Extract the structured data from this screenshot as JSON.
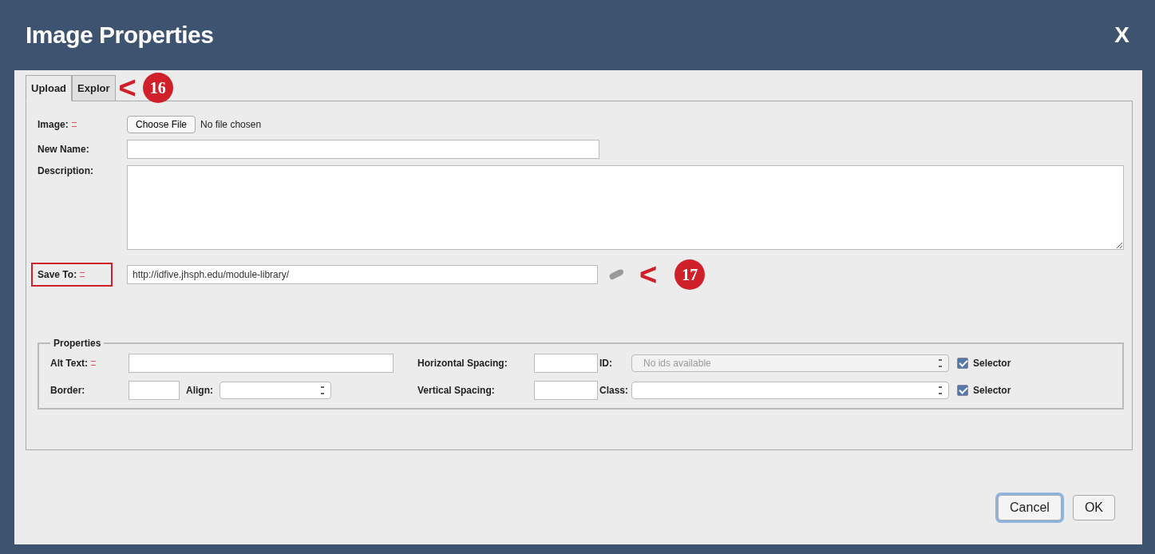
{
  "window": {
    "title": "Image Properties",
    "close": "X"
  },
  "tabs": [
    {
      "label": "Upload",
      "selected": true
    },
    {
      "label": "Explor",
      "selected": false
    }
  ],
  "callouts": [
    {
      "arrow": "<",
      "number": "16"
    },
    {
      "arrow": "<",
      "number": "17"
    }
  ],
  "upload": {
    "image": {
      "label": "Image:",
      "required": true,
      "button": "Choose File",
      "status": "No file chosen"
    },
    "new_name": {
      "label": "New Name:",
      "required": false
    },
    "description": {
      "label": "Description:",
      "required": false
    },
    "save_to": {
      "label": "Save To:",
      "required": true,
      "highlighted": true,
      "value": "http://idfive.jhsph.edu/module-library/"
    }
  },
  "properties": {
    "legend": "Properties",
    "alt_text": {
      "label": "Alt Text:",
      "required": true
    },
    "border": {
      "label": "Border:"
    },
    "align": {
      "label": "Align:"
    },
    "horizontal_spacing": {
      "label": "Horizontal Spacing:"
    },
    "vertical_spacing": {
      "label": "Vertical Spacing:"
    },
    "id": {
      "label": "ID:",
      "value": "No ids available",
      "disabled": true,
      "selector": {
        "label": "Selector",
        "checked": true
      }
    },
    "class": {
      "label": "Class:",
      "disabled": false,
      "selector": {
        "label": "Selector",
        "checked": true
      }
    }
  },
  "buttons": [
    {
      "label": "Cancel",
      "selected": true
    },
    {
      "label": "OK",
      "selected": false
    }
  ]
}
